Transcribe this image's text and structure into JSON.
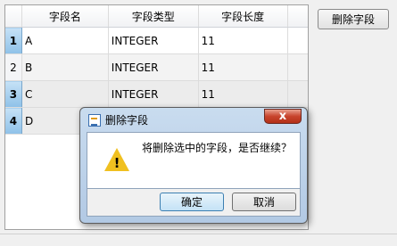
{
  "grid": {
    "columns": [
      "字段名",
      "字段类型",
      "字段长度"
    ],
    "rows": [
      {
        "num": "1",
        "name": "A",
        "type": "INTEGER",
        "length": "11"
      },
      {
        "num": "2",
        "name": "B",
        "type": "INTEGER",
        "length": "11"
      },
      {
        "num": "3",
        "name": "C",
        "type": "INTEGER",
        "length": "11"
      },
      {
        "num": "4",
        "name": "D",
        "type": "",
        "length": ""
      }
    ]
  },
  "toolbar": {
    "delete_field_label": "删除字段"
  },
  "dialog": {
    "title": "删除字段",
    "close_label": "x",
    "message": "将删除选中的字段，是否继续？",
    "warning_mark": "!",
    "ok_label": "确定",
    "cancel_label": "取消"
  }
}
